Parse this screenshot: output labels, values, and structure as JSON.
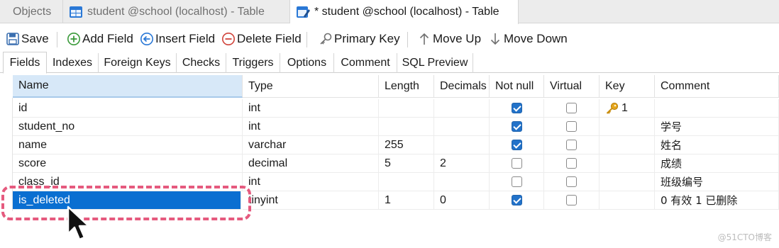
{
  "window_tabs": {
    "objects": "Objects",
    "tab1": "student @school (localhost) - Table",
    "tab2": "* student @school (localhost) - Table"
  },
  "toolbar": {
    "save": "Save",
    "add_field": "Add Field",
    "insert_field": "Insert Field",
    "delete_field": "Delete Field",
    "primary_key": "Primary Key",
    "move_up": "Move Up",
    "move_down": "Move Down"
  },
  "sub_tabs": [
    "Fields",
    "Indexes",
    "Foreign Keys",
    "Checks",
    "Triggers",
    "Options",
    "Comment",
    "SQL Preview"
  ],
  "columns": [
    "Name",
    "Type",
    "Length",
    "Decimals",
    "Not null",
    "Virtual",
    "Key",
    "Comment"
  ],
  "rows": [
    {
      "name": "id",
      "type": "int",
      "length": "",
      "decimals": "",
      "not_null": true,
      "virtual": false,
      "key": "1",
      "comment": ""
    },
    {
      "name": "student_no",
      "type": "int",
      "length": "",
      "decimals": "",
      "not_null": true,
      "virtual": false,
      "key": "",
      "comment": "学号"
    },
    {
      "name": "name",
      "type": "varchar",
      "length": "255",
      "decimals": "",
      "not_null": true,
      "virtual": false,
      "key": "",
      "comment": "姓名"
    },
    {
      "name": "score",
      "type": "decimal",
      "length": "5",
      "decimals": "2",
      "not_null": false,
      "virtual": false,
      "key": "",
      "comment": "成绩"
    },
    {
      "name": "class_id",
      "type": "int",
      "length": "",
      "decimals": "",
      "not_null": false,
      "virtual": false,
      "key": "",
      "comment": "班级编号"
    },
    {
      "name": "is_deleted",
      "type": "tinyint",
      "length": "1",
      "decimals": "0",
      "not_null": true,
      "virtual": false,
      "key": "",
      "comment": "0 有效 1 已删除"
    }
  ],
  "watermark": "@51CTO博客",
  "colors": {
    "selection": "#0a6fd1",
    "highlight_border": "#e55a7e",
    "checkbox_on": "#2272c9",
    "header_selected": "#d7e8f8"
  }
}
